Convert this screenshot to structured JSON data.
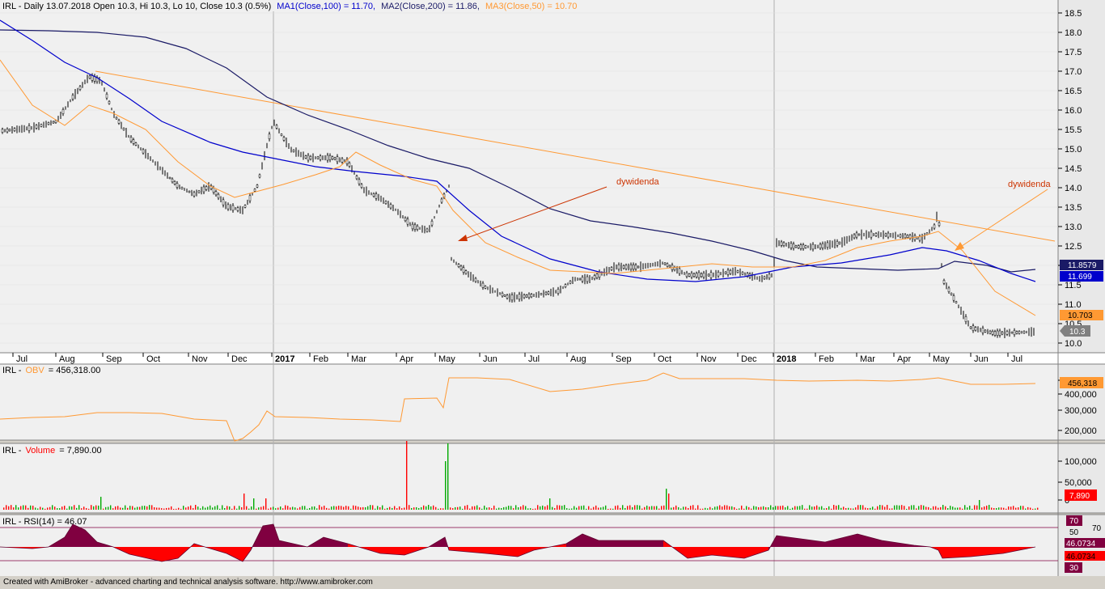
{
  "main_pane": {
    "symbol": "IRL",
    "header_text": "IRL - Daily 13.07.2018 Open 10.3, Hi 10.3, Lo 10, Close 10.3 (0.5%)",
    "ma1_text": "MA1(Close,100) = 11.70,",
    "ma2_text": "MA2(Close,200) = 11.86,",
    "ma3_text": "MA3(Close,50) = 10.70",
    "y_axis_labels": [
      "18.5",
      "18.0",
      "17.5",
      "17.0",
      "16.5",
      "16.0",
      "15.5",
      "15.0",
      "14.5",
      "14.0",
      "13.5",
      "13.0",
      "12.5",
      "12.0",
      "11.5",
      "11.0",
      "10.5",
      "10.0"
    ],
    "price_tags": {
      "ma2": "11.8579",
      "ma1": "11.699",
      "ma3": "10.703",
      "close": "10.3"
    },
    "annotations": [
      "dywidenda",
      "dywidenda"
    ],
    "colors": {
      "ma1": "#0000cc",
      "ma2": "#1a1a66",
      "ma3": "#ff9933",
      "trendline": "#ff9933",
      "arrow": "#cc3300",
      "price_bars": "#000000",
      "background": "#f0f0f0"
    }
  },
  "date_axis": {
    "labels": [
      "Jul",
      "Aug",
      "Sep",
      "Oct",
      "Nov",
      "Dec",
      "2017",
      "Feb",
      "Mar",
      "Apr",
      "May",
      "Jun",
      "Jul",
      "Aug",
      "Sep",
      "Oct",
      "Nov",
      "Dec",
      "2018",
      "Feb",
      "Mar",
      "Apr",
      "May",
      "Jun",
      "Jul"
    ]
  },
  "obv_pane": {
    "title_prefix": "IRL -",
    "indicator_name": "OBV",
    "value_text": "= 456,318.00",
    "y_axis_labels": [
      "500,000",
      "400,000",
      "300,000",
      "200,000"
    ],
    "last_value_tag": "456,318",
    "color": "#ff9933"
  },
  "volume_pane": {
    "title_prefix": "IRL -",
    "indicator_name": "Volume",
    "value_text": "= 7,890.00",
    "y_axis_labels": [
      "100,000",
      "50,000",
      "0"
    ],
    "last_value_tag": "7,890",
    "colors": {
      "up": "#00aa00",
      "down": "#ff0000"
    }
  },
  "rsi_pane": {
    "title": "IRL - RSI(14) = 46.07",
    "y_axis_labels": [
      "70",
      "50",
      "70",
      "30"
    ],
    "value_tags": [
      "46.0734",
      "46.0734"
    ],
    "colors": {
      "fill_above": "#800040",
      "fill_below": "#ff0000"
    }
  },
  "footer": {
    "text": "Created with AmiBroker - advanced charting and technical analysis software. http://www.amibroker.com"
  }
}
